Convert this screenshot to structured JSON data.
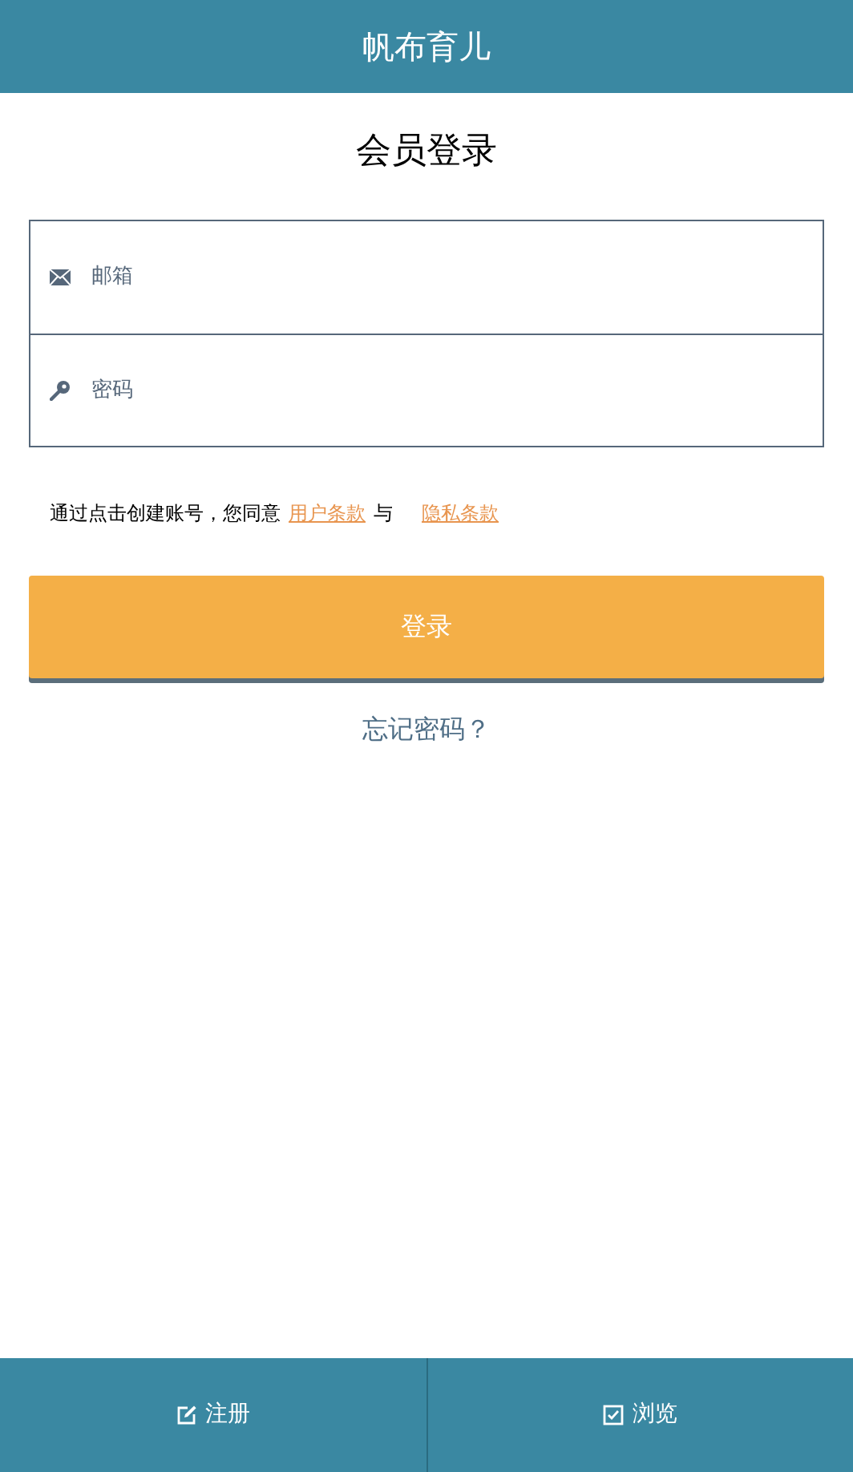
{
  "header": {
    "title": "帆布育儿"
  },
  "page_title": "会员登录",
  "fields": [
    {
      "kind": "email",
      "placeholder": "邮箱"
    },
    {
      "kind": "password",
      "placeholder": "密码"
    }
  ],
  "agreement": {
    "text": "通过点击创建账号，您同意",
    "link_1": "用户条款",
    "joiner": "与",
    "link_2": "隐私条款"
  },
  "login_button": "登录",
  "forgot_link": "忘记密码？",
  "bottom_tabs": [
    {
      "kind": "register",
      "label": "注册"
    },
    {
      "kind": "browse",
      "label": "浏览"
    }
  ]
}
